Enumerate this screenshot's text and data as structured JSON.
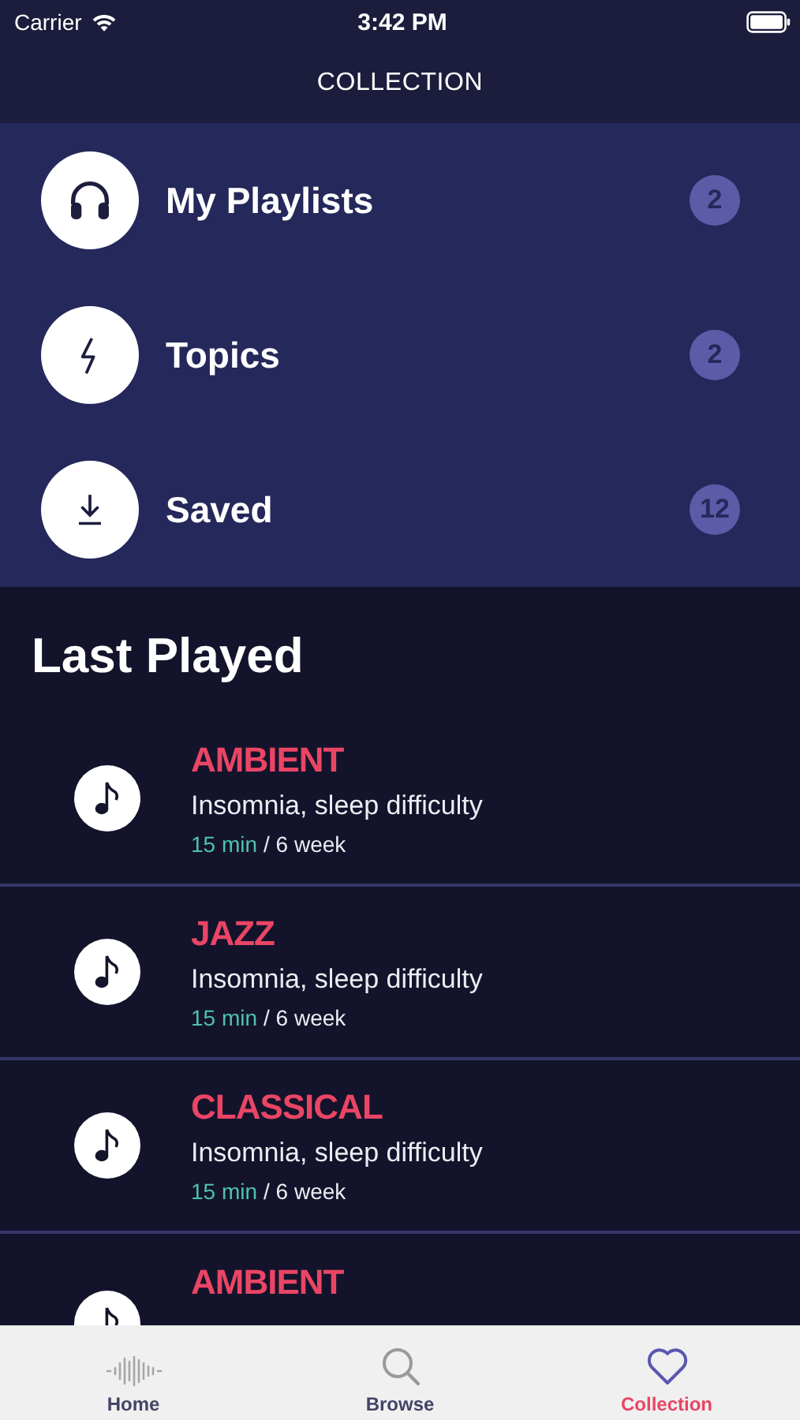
{
  "status_bar": {
    "carrier": "Carrier",
    "time": "3:42 PM"
  },
  "header": {
    "title": "COLLECTION"
  },
  "collections": [
    {
      "label": "My Playlists",
      "count": "2"
    },
    {
      "label": "Topics",
      "count": "2"
    },
    {
      "label": "Saved",
      "count": "12"
    }
  ],
  "last_played": {
    "heading": "Last Played",
    "items": [
      {
        "genre": "AMBIENT",
        "subtitle": "Insomnia, sleep difficulty",
        "duration": "15 min",
        "frequency": "/ 6 week"
      },
      {
        "genre": "JAZZ",
        "subtitle": "Insomnia, sleep difficulty",
        "duration": "15 min",
        "frequency": "/ 6 week"
      },
      {
        "genre": "CLASSICAL",
        "subtitle": "Insomnia, sleep difficulty",
        "duration": "15 min",
        "frequency": "/ 6 week"
      },
      {
        "genre": "AMBIENT"
      }
    ]
  },
  "tab_bar": [
    {
      "label": "Home",
      "selected": false
    },
    {
      "label": "Browse",
      "selected": false
    },
    {
      "label": "Collection",
      "selected": true
    }
  ]
}
